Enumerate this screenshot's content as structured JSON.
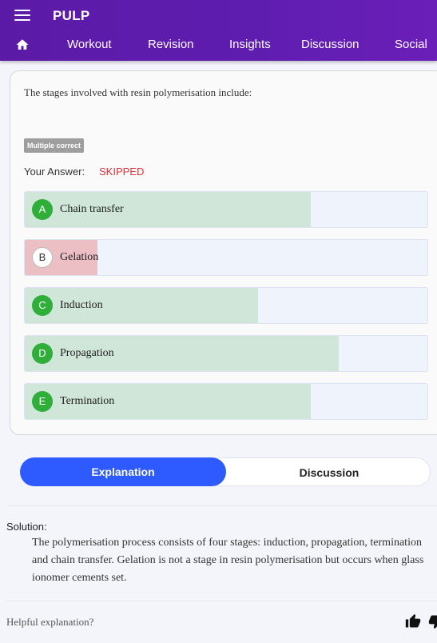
{
  "app": {
    "title": "PULP"
  },
  "nav": {
    "items": [
      "Workout",
      "Revision",
      "Insights",
      "Discussion",
      "Social"
    ]
  },
  "question": {
    "text": "The stages involved with resin polymerisation include:",
    "tag": "Multiple correct",
    "your_answer_label": "Your Answer:",
    "your_answer_value": "SKIPPED",
    "options": [
      {
        "letter": "A",
        "label": "Chain transfer",
        "status": "correct",
        "response_share": 0.71
      },
      {
        "letter": "B",
        "label": "Gelation",
        "status": "incorrect",
        "response_share": 0.18
      },
      {
        "letter": "C",
        "label": "Induction",
        "status": "correct",
        "response_share": 0.58
      },
      {
        "letter": "D",
        "label": "Propagation",
        "status": "correct",
        "response_share": 0.78
      },
      {
        "letter": "E",
        "label": "Termination",
        "status": "correct",
        "response_share": 0.71
      }
    ]
  },
  "tabs": {
    "explanation": "Explanation",
    "discussion": "Discussion"
  },
  "solution": {
    "label": "Solution:",
    "text": "The polymerisation process consists of four stages: induction, propagation, termination and chain transfer. Gelation is not a stage in resin polymerisation but occurs when glass ionomer cements set."
  },
  "feedback": {
    "prompt": "Helpful explanation?"
  },
  "colors": {
    "brand": "#5f1db0",
    "accent": "#2e5bff",
    "correct": "#2fae3a",
    "skipped": "#d9343e"
  }
}
